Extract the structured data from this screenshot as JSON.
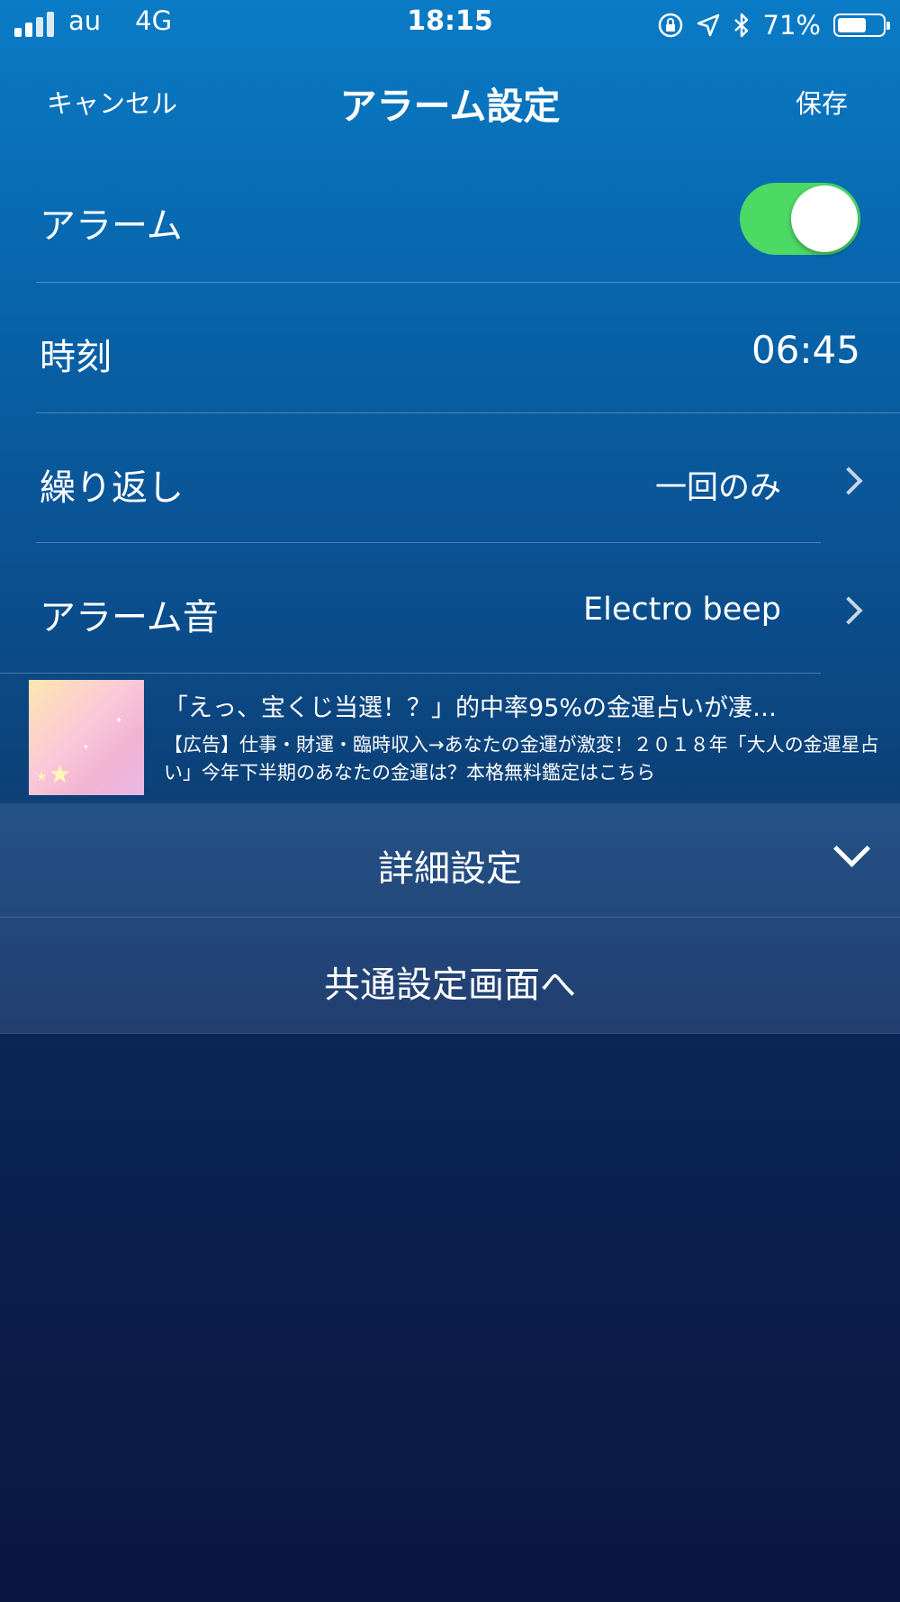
{
  "status_bar": {
    "carrier": "au",
    "network": "4G",
    "time": "18:15",
    "battery": "71%",
    "battery_level": 0.71
  },
  "nav": {
    "cancel": "キャンセル",
    "title": "アラーム設定",
    "save": "保存"
  },
  "rows": {
    "alarm": {
      "label": "アラーム",
      "enabled": true
    },
    "time": {
      "label": "時刻",
      "value": "06:45"
    },
    "repeat": {
      "label": "繰り返し",
      "value": "一回のみ"
    },
    "sound": {
      "label": "アラーム音",
      "value": "Electro beep"
    }
  },
  "ad": {
    "title": "「えっ、宝くじ当選！？」的中率95%の金運占いが凄…",
    "body": "【広告】仕事・財運・臨時収入→あなたの金運が激変！２０１８年「大人の金運星占い」今年下半期のあなたの金運は？本格無料鑑定はこちら"
  },
  "sections": {
    "advanced": "詳細設定",
    "common": "共通設定画面へ"
  },
  "colors": {
    "toggle_on": "#4cd964",
    "bg_top": "#0a7bc6",
    "bg_bottom": "#0a1640"
  }
}
